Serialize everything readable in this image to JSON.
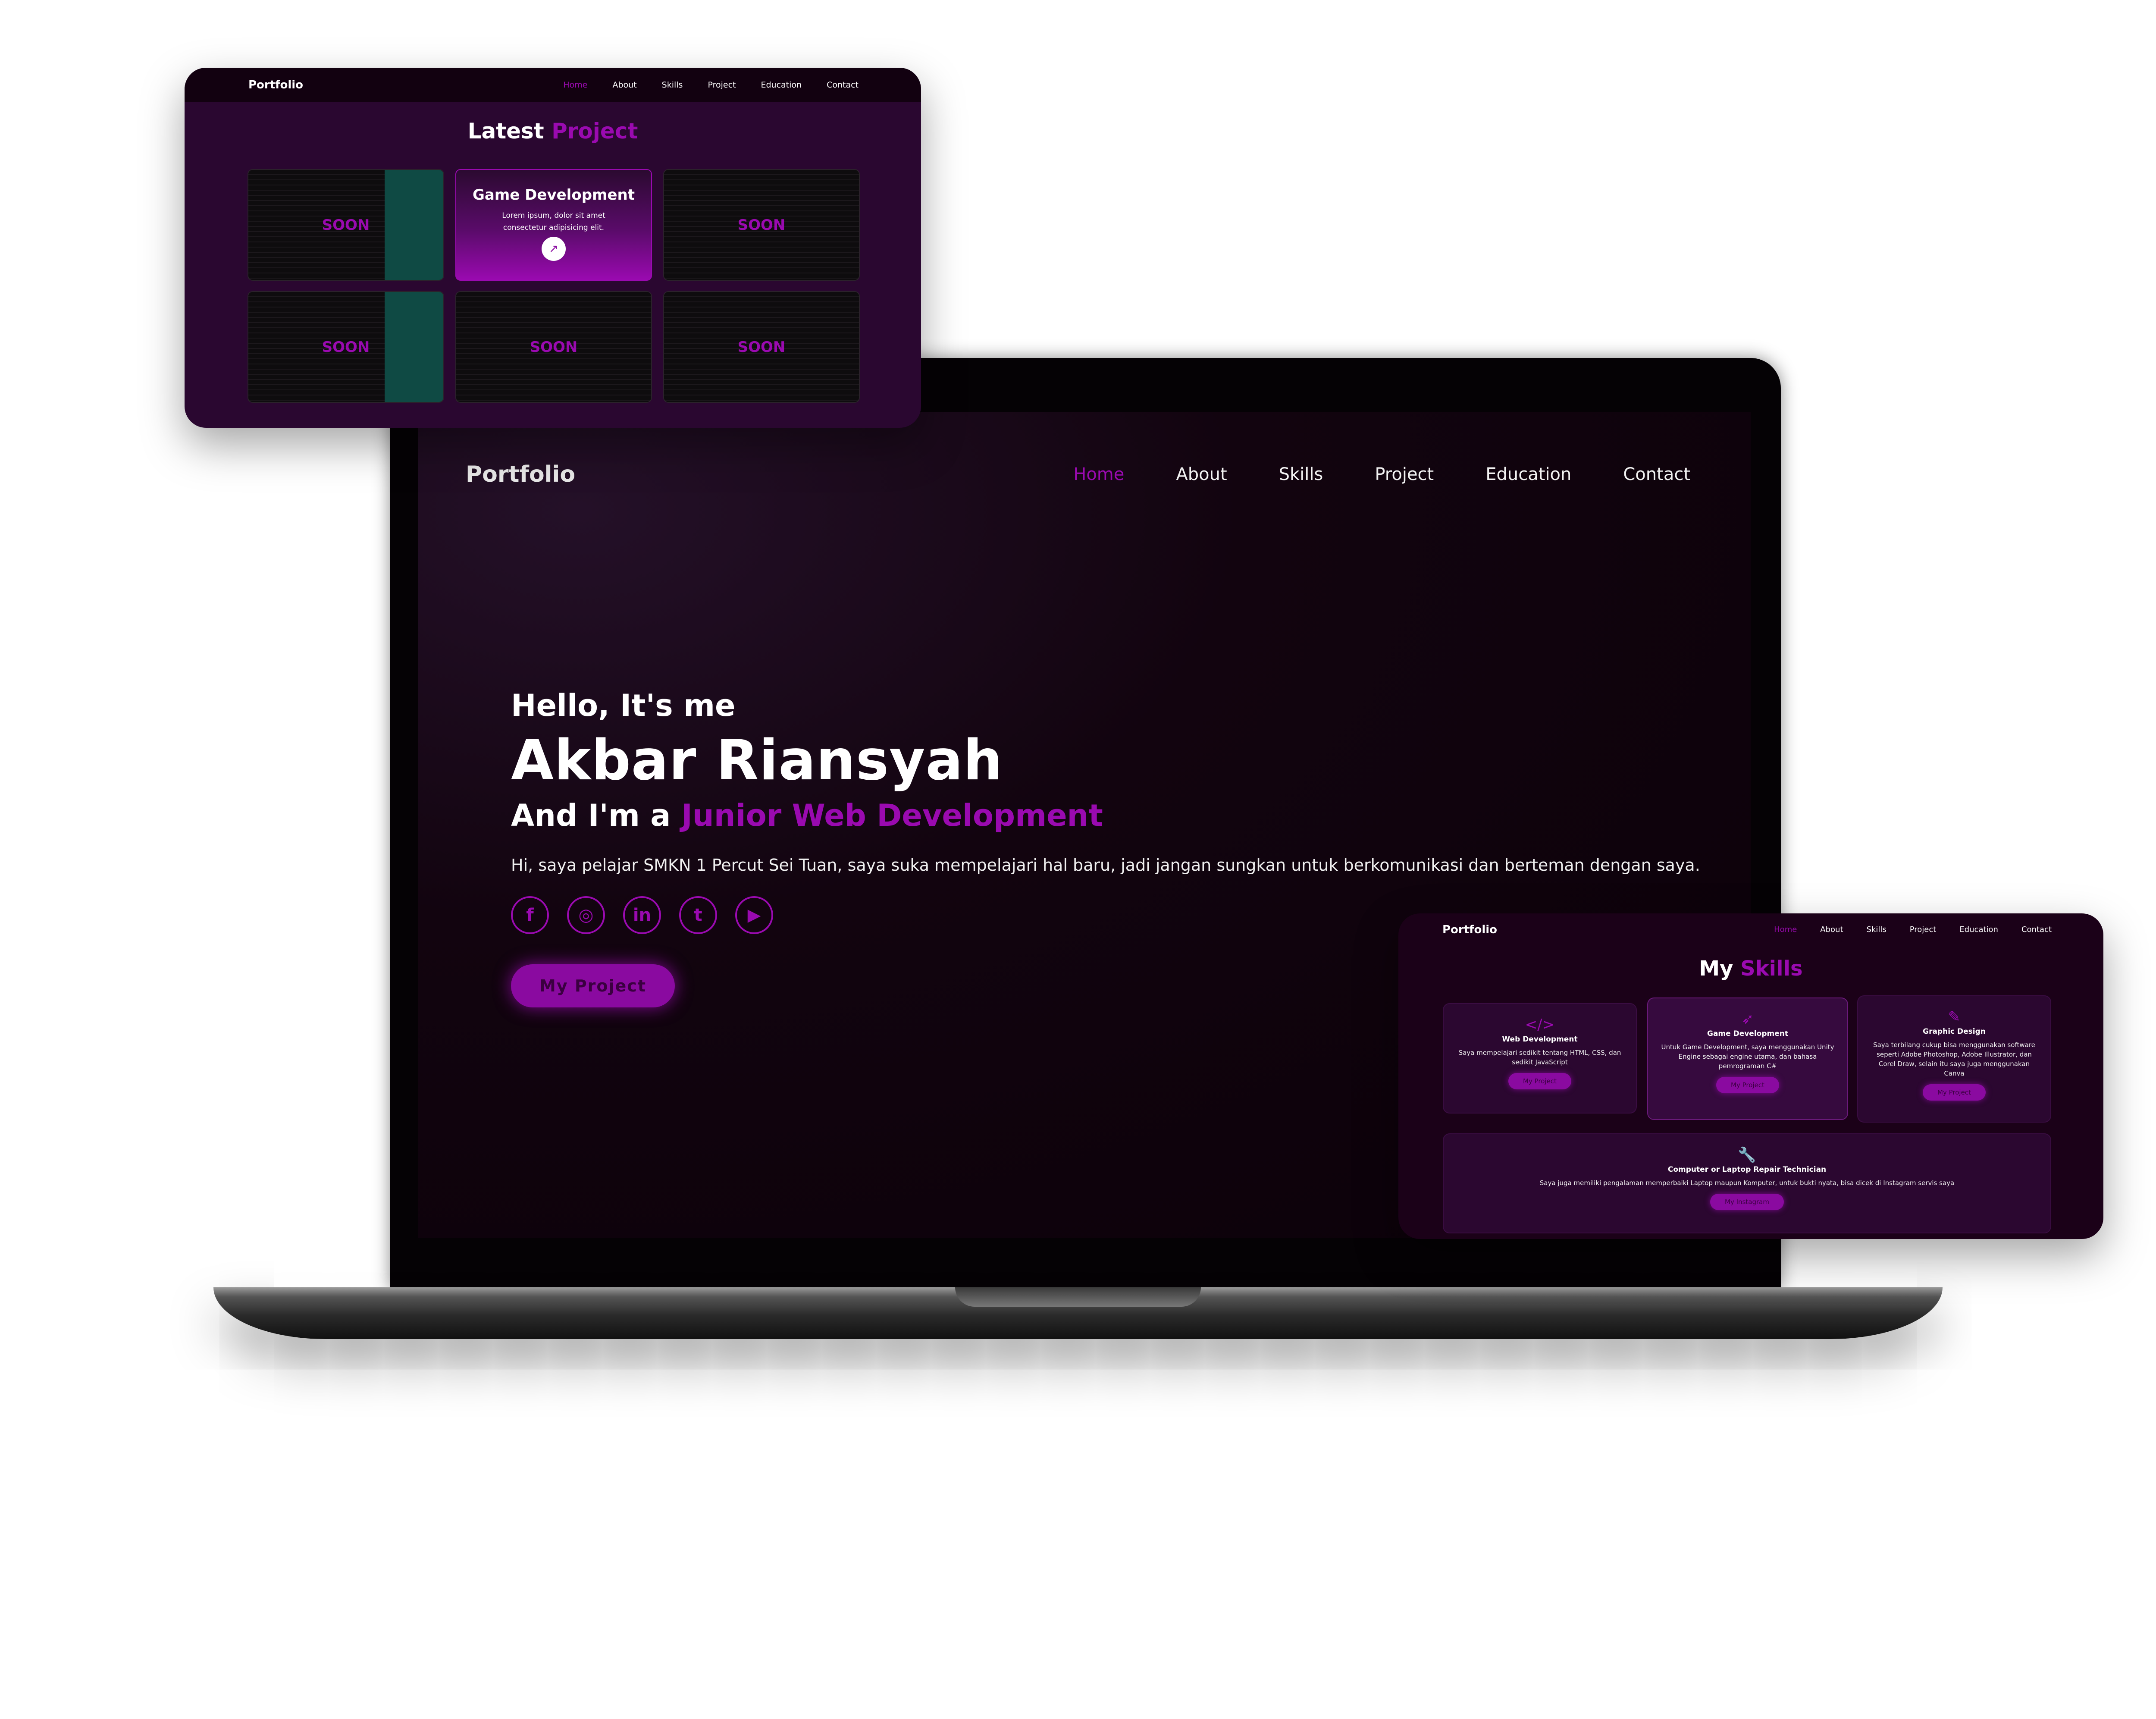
{
  "main": {
    "nav": {
      "logo": "Portfolio",
      "items": [
        "Home",
        "About",
        "Skills",
        "Project",
        "Education",
        "Contact"
      ]
    },
    "hero": {
      "greeting": "Hello, It's me",
      "name": "Akbar Riansyah",
      "role_prefix": "And I'm a",
      "role": "Junior Web Development",
      "description": "Hi, saya pelajar SMKN 1 Percut Sei Tuan, saya suka mempelajari hal baru, jadi jangan sungkan untuk berkomunikasi dan berteman dengan saya.",
      "socials": [
        {
          "icon": "facebook-icon",
          "glyph": "f"
        },
        {
          "icon": "instagram-icon",
          "glyph": "◎"
        },
        {
          "icon": "linkedin-icon",
          "glyph": "in"
        },
        {
          "icon": "twitter-icon",
          "glyph": "t"
        },
        {
          "icon": "youtube-icon",
          "glyph": "▶"
        }
      ],
      "button": "My Project"
    }
  },
  "project_panel": {
    "nav": {
      "logo": "Portfolio",
      "items": [
        "Home",
        "About",
        "Skills",
        "Project",
        "Education",
        "Contact"
      ]
    },
    "title_part1": "Latest",
    "title_part2": "Project",
    "soon_label": "SOON",
    "feature": {
      "title": "Game Development",
      "description": "Lorem ipsum, dolor sit amet consectetur adipisicing elit."
    }
  },
  "skills_panel": {
    "nav": {
      "logo": "Portfolio",
      "items": [
        "Home",
        "About",
        "Skills",
        "Project",
        "Education",
        "Contact"
      ]
    },
    "title_part1": "My",
    "title_part2": "Skills",
    "cards": [
      {
        "title": "Web Development",
        "text": "Saya mempelajari sedikit tentang HTML, CSS, dan sedikit JavaScript",
        "button": "My Project"
      },
      {
        "title": "Game Development",
        "text": "Untuk Game Development, saya menggunakan Unity Engine sebagai engine utama, dan bahasa pemrograman C#",
        "button": "My Project"
      },
      {
        "title": "Graphic Design",
        "text": "Saya terbilang cukup bisa menggunakan software seperti Adobe Photoshop, Adobe Illustrator, dan Corel Draw, selain itu saya juga menggunakan Canva",
        "button": "My Project"
      },
      {
        "title": "Computer or Laptop Repair Technician",
        "text": "Saya juga memiliki pengalaman memperbaiki Laptop maupun Komputer, untuk bukti nyata, bisa dicek di Instagram servis saya",
        "button": "My Instagram"
      }
    ]
  },
  "colors": {
    "accent": "#9a0ab0",
    "background": "#0b0109",
    "text": "#ffffff"
  }
}
